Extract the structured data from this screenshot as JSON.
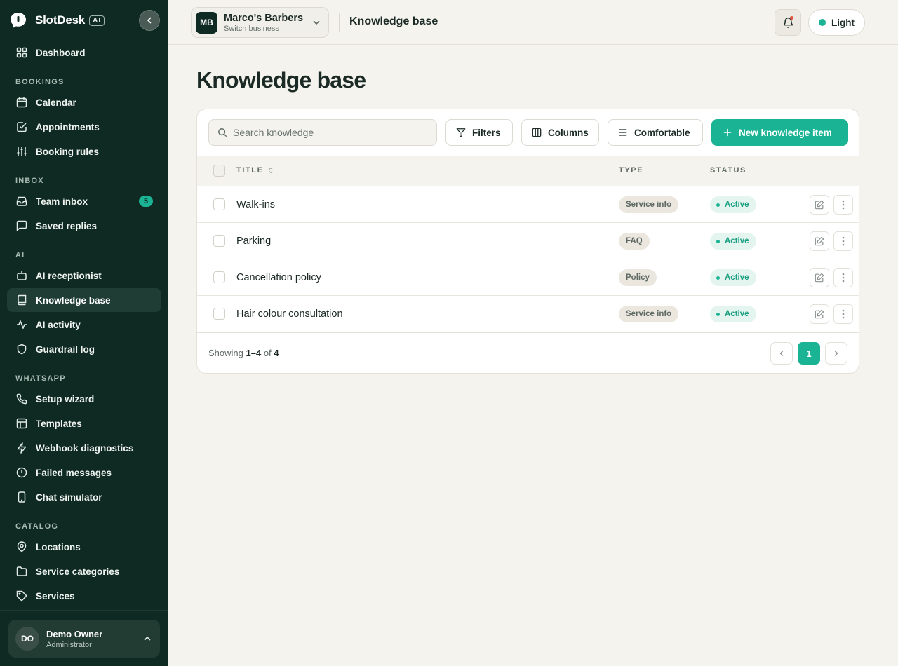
{
  "brand": {
    "name": "SlotDesk",
    "badge": "AI"
  },
  "sidebar": {
    "top": [
      {
        "label": "Dashboard",
        "icon": "grid-icon"
      }
    ],
    "sections": [
      {
        "title": "BOOKINGS",
        "items": [
          {
            "label": "Calendar",
            "icon": "calendar-icon"
          },
          {
            "label": "Appointments",
            "icon": "checklist-icon"
          },
          {
            "label": "Booking rules",
            "icon": "sliders-icon"
          }
        ]
      },
      {
        "title": "INBOX",
        "items": [
          {
            "label": "Team inbox",
            "icon": "inbox-icon",
            "count": "5"
          },
          {
            "label": "Saved replies",
            "icon": "message-icon"
          }
        ]
      },
      {
        "title": "AI",
        "items": [
          {
            "label": "AI receptionist",
            "icon": "bot-icon"
          },
          {
            "label": "Knowledge base",
            "icon": "book-icon",
            "active": true
          },
          {
            "label": "AI activity",
            "icon": "activity-icon"
          },
          {
            "label": "Guardrail log",
            "icon": "shield-icon"
          }
        ]
      },
      {
        "title": "WHATSAPP",
        "items": [
          {
            "label": "Setup wizard",
            "icon": "phone-icon"
          },
          {
            "label": "Templates",
            "icon": "layout-icon"
          },
          {
            "label": "Webhook diagnostics",
            "icon": "bolt-icon"
          },
          {
            "label": "Failed messages",
            "icon": "alert-icon"
          },
          {
            "label": "Chat simulator",
            "icon": "device-icon"
          }
        ]
      },
      {
        "title": "CATALOG",
        "items": [
          {
            "label": "Locations",
            "icon": "pin-icon"
          },
          {
            "label": "Service categories",
            "icon": "folder-icon"
          },
          {
            "label": "Services",
            "icon": "tag-icon"
          }
        ]
      }
    ],
    "user": {
      "initials": "DO",
      "name": "Demo Owner",
      "role": "Administrator"
    }
  },
  "topbar": {
    "business": {
      "initials": "MB",
      "name": "Marco's Barbers",
      "sub": "Switch business"
    },
    "title": "Knowledge base",
    "theme_label": "Light"
  },
  "page": {
    "title": "Knowledge base",
    "search_placeholder": "Search knowledge",
    "filters_label": "Filters",
    "columns_label": "Columns",
    "density_label": "Comfortable",
    "new_label": "New knowledge item",
    "columns": {
      "title": "TITLE",
      "type": "TYPE",
      "status": "STATUS"
    },
    "rows": [
      {
        "title": "Walk-ins",
        "type": "Service info",
        "status": "Active"
      },
      {
        "title": "Parking",
        "type": "FAQ",
        "status": "Active"
      },
      {
        "title": "Cancellation policy",
        "type": "Policy",
        "status": "Active"
      },
      {
        "title": "Hair colour consultation",
        "type": "Service info",
        "status": "Active"
      }
    ],
    "footer": {
      "showing": "Showing",
      "range": "1–4",
      "of": "of",
      "total": "4",
      "page": "1"
    }
  },
  "colors": {
    "sidebar": "#0f2a22",
    "accent": "#1ab394",
    "background": "#f4f3ee"
  }
}
